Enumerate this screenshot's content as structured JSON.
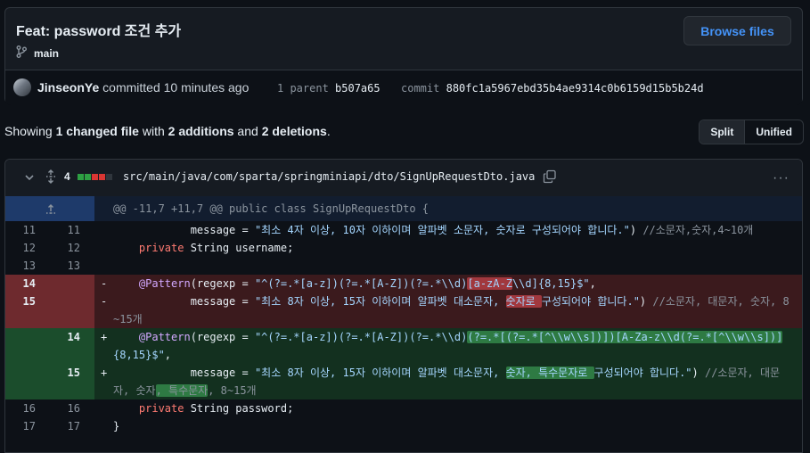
{
  "commit": {
    "title": "Feat: password 조건 추가",
    "branch": "main",
    "browse_label": "Browse files",
    "author": "JinseonYe",
    "action": "committed 10 minutes ago",
    "parent_label": "1 parent",
    "parent_hash": "b507a65",
    "commit_label": "commit",
    "commit_hash": "880fc1a5967ebd35b4ae9314c0b6159d15b5b24d"
  },
  "summary": {
    "prefix": "Showing ",
    "changed": "1 changed file",
    "mid1": " with ",
    "additions": "2 additions",
    "mid2": " and ",
    "deletions": "2 deletions",
    "suffix": "."
  },
  "view_toggle": {
    "split": "Split",
    "unified": "Unified"
  },
  "file": {
    "change_count": "4",
    "path": "src/main/java/com/sparta/springminiapi/dto/SignUpRequestDto.java",
    "hunk_header": "@@ -11,7 +11,7 @@ public class SignUpRequestDto {",
    "rows": [
      {
        "old": "11",
        "new": "11",
        "sign": "",
        "type": "ctx"
      },
      {
        "old": "12",
        "new": "12",
        "sign": "",
        "type": "ctx"
      },
      {
        "old": "13",
        "new": "13",
        "sign": "",
        "type": "ctx"
      },
      {
        "old": "14",
        "new": "",
        "sign": "-",
        "type": "del"
      },
      {
        "old": "15",
        "new": "",
        "sign": "-",
        "type": "del"
      },
      {
        "old": "",
        "new": "14",
        "sign": "+",
        "type": "add"
      },
      {
        "old": "",
        "new": "15",
        "sign": "+",
        "type": "add"
      },
      {
        "old": "16",
        "new": "16",
        "sign": "",
        "type": "ctx"
      },
      {
        "old": "17",
        "new": "17",
        "sign": "",
        "type": "ctx"
      }
    ],
    "code": {
      "l11_a": "            message = ",
      "l11_str": "\"최소 4자 이상, 10자 이하이며 알파벳 소문자, 숫자로 구성되어야 합니다.\"",
      "l11_b": ") ",
      "l11_cmt": "//소문자,숫자,4~10개",
      "l12_a": "    ",
      "l12_kw": "private",
      "l12_b": " String username;",
      "l13": "",
      "d14_a": "    ",
      "d14_ann": "@Pattern",
      "d14_b": "(regexp = ",
      "d14_str1": "\"^(?=.*[a-z])(?=.*[A-Z])(?=.*\\\\d)",
      "d14_hl": "[a-zA-Z",
      "d14_str2": "\\\\d]{8,15}$\"",
      "d14_c": ",",
      "d15_a": "            message = ",
      "d15_str1": "\"최소 8자 이상, 15자 이하이며 알파벳 대소문자, ",
      "d15_hl": "숫자로 ",
      "d15_str2": "구성되어야 합니다.\"",
      "d15_b": ") ",
      "d15_cmt": "//소문자, 대문자, 숫자, 8~15개",
      "a14_a": "    ",
      "a14_ann": "@Pattern",
      "a14_b": "(regexp = ",
      "a14_str1": "\"^(?=.*[a-z])(?=.*[A-Z])(?=.*\\\\d)",
      "a14_hl": "(?=.*[(?=.*[^\\\\w\\\\s])])[A-Za-z\\\\d(?=.*[^\\\\w\\\\s])]",
      "a14_str2": "{8,15}$\"",
      "a14_c": ",",
      "a15_a": "            message = ",
      "a15_str1": "\"최소 8자 이상, 15자 이하이며 알파벳 대소문자, ",
      "a15_hl": "숫자, 특수문자로 ",
      "a15_str2": "구성되어야 합니다.\"",
      "a15_b": ") ",
      "a15_cmt1": "//소문자, 대문자, 숫자",
      "a15_hl2": ", 특수문자",
      "a15_cmt2": ", 8~15개",
      "l16_a": "    ",
      "l16_kw": "private",
      "l16_b": " String password;",
      "l17": "}"
    }
  },
  "colors": {
    "accent_link": "#4493f8",
    "addition_bar": "#2ea043",
    "deletion_bar": "#da3633",
    "neutral_bar": "#30363d"
  },
  "icons": [
    "git-branch-icon",
    "chevron-down-icon",
    "unfold-icon",
    "copy-icon",
    "kebab-horizontal-icon",
    "avatar"
  ]
}
